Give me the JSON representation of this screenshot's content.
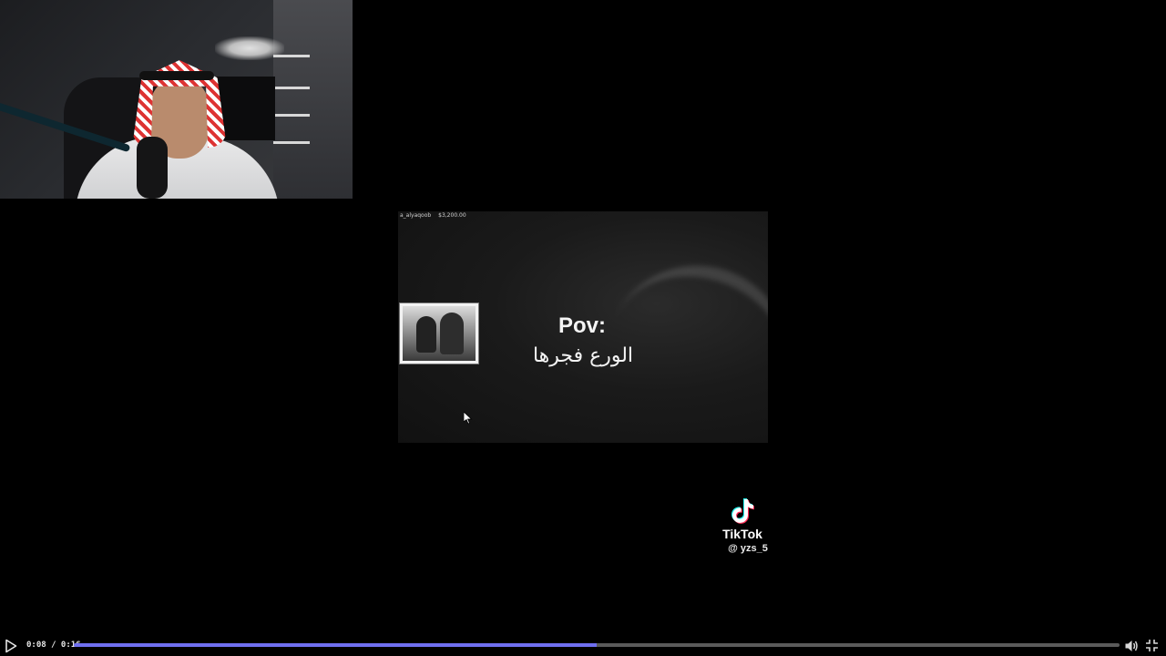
{
  "clip": {
    "header_user": "a_alyaqoob",
    "header_amount": "$3,200.00",
    "title": "Pov:",
    "caption": "الورع فجرها"
  },
  "watermark": {
    "brand": "TikTok",
    "handle": "@ yzs_5",
    "icon": "tiktok-logo-icon"
  },
  "player": {
    "time": "0:08 / 0:16",
    "progress": 0.5,
    "progress_color": "#6f6ff0",
    "play_icon": "play-icon",
    "volume_icon": "volume-icon",
    "fullscreen_icon": "exit-fullscreen-icon"
  }
}
